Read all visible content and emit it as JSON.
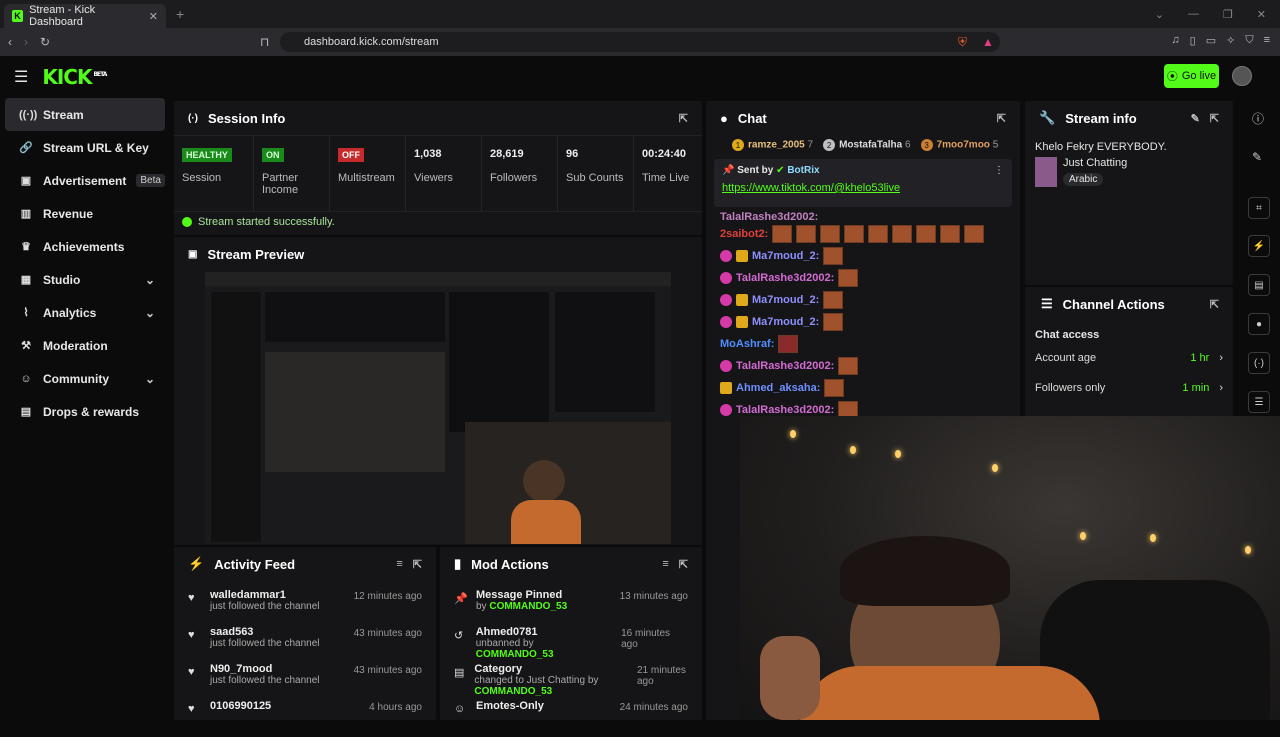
{
  "browser": {
    "tab_title": "Stream - Kick Dashboard",
    "url": "dashboard.kick.com/stream"
  },
  "topbar": {
    "logo": "KICK",
    "logo_sup": "BETA",
    "go_live": "Go live"
  },
  "sidebar": {
    "items": [
      {
        "label": "Stream",
        "icon": "broadcast-icon"
      },
      {
        "label": "Stream URL & Key",
        "icon": "link-icon"
      },
      {
        "label": "Advertisement",
        "icon": "ad-icon",
        "badge": "Beta"
      },
      {
        "label": "Revenue",
        "icon": "bar-chart-icon"
      },
      {
        "label": "Achievements",
        "icon": "trophy-icon"
      },
      {
        "label": "Studio",
        "icon": "studio-icon"
      },
      {
        "label": "Analytics",
        "icon": "analytics-icon"
      },
      {
        "label": "Moderation",
        "icon": "hammer-icon"
      },
      {
        "label": "Community",
        "icon": "community-icon"
      },
      {
        "label": "Drops & rewards",
        "icon": "gift-icon"
      }
    ]
  },
  "session": {
    "title": "Session Info",
    "stats": [
      {
        "value": "HEALTHY",
        "label": "Session"
      },
      {
        "value": "ON",
        "label": "Partner Income"
      },
      {
        "value": "OFF",
        "label": "Multistream"
      },
      {
        "value": "1,038",
        "label": "Viewers"
      },
      {
        "value": "28,619",
        "label": "Followers"
      },
      {
        "value": "96",
        "label": "Sub Counts"
      },
      {
        "value": "00:24:40",
        "label": "Time Live"
      }
    ],
    "success": "Stream started successfully."
  },
  "preview": {
    "title": "Stream Preview"
  },
  "activity": {
    "title": "Activity Feed",
    "rows": [
      {
        "name": "walledammar1",
        "sub": "just followed the channel",
        "time": "12 minutes ago"
      },
      {
        "name": "saad563",
        "sub": "just followed the channel",
        "time": "43 minutes ago"
      },
      {
        "name": "N90_7mood",
        "sub": "just followed the channel",
        "time": "43 minutes ago"
      },
      {
        "name": "0106990125",
        "sub": "",
        "time": "4 hours ago"
      }
    ]
  },
  "mod": {
    "title": "Mod Actions",
    "rows": [
      {
        "name": "Message Pinned",
        "pre": "by ",
        "who": "COMMANDO_53",
        "time": "13 minutes ago"
      },
      {
        "name": "Ahmed0781",
        "pre": "unbanned by ",
        "who": "COMMANDO_53",
        "time": "16 minutes ago"
      },
      {
        "name": "Category",
        "pre": "changed to Just Chatting by ",
        "who": "COMMANDO_53",
        "time": "21 minutes ago"
      },
      {
        "name": "Emotes-Only",
        "pre": "",
        "who": "",
        "time": "24 minutes ago"
      }
    ]
  },
  "chat": {
    "title": "Chat",
    "leaders": [
      {
        "rank": "1",
        "name": "ramze_2005",
        "count": "7",
        "color": "#e0a81b"
      },
      {
        "rank": "2",
        "name": "MostafaTalha",
        "count": "6",
        "color": "#c0c0c0"
      },
      {
        "rank": "3",
        "name": "7moo7moo",
        "count": "5",
        "color": "#cd7f32"
      }
    ],
    "pinned": {
      "sent_by": "Sent by",
      "bot": "BotRix",
      "link": "https://www.tiktok.com/@khelo53live"
    },
    "messages": [
      {
        "user": "TalalRashe3d2002:",
        "color": "#d26bd2"
      },
      {
        "user": "2saibot2:",
        "color": "#e0403a"
      },
      {
        "user": "Ma7moud_2:",
        "color": "#8f8fff"
      },
      {
        "user": "TalalRashe3d2002:",
        "color": "#d26bd2"
      },
      {
        "user": "Ma7moud_2:",
        "color": "#8f8fff"
      },
      {
        "user": "Ma7moud_2:",
        "color": "#8f8fff"
      },
      {
        "user": "MoAshraf:",
        "color": "#4f8fff"
      },
      {
        "user": "TalalRashe3d2002:",
        "color": "#d26bd2"
      },
      {
        "user": "Ahmed_aksaha:",
        "color": "#6f8fff"
      },
      {
        "user": "TalalRashe3d2002:",
        "color": "#d26bd2"
      }
    ]
  },
  "stream_info": {
    "title": "Stream info",
    "stream_title": "Khelo Fekry EVERYBODY.",
    "category": "Just Chatting",
    "language": "Arabic"
  },
  "channel_actions": {
    "title": "Channel Actions",
    "section": "Chat access",
    "rows": [
      {
        "label": "Account age",
        "value": "1 hr"
      },
      {
        "label": "Followers only",
        "value": "1 min"
      }
    ]
  }
}
